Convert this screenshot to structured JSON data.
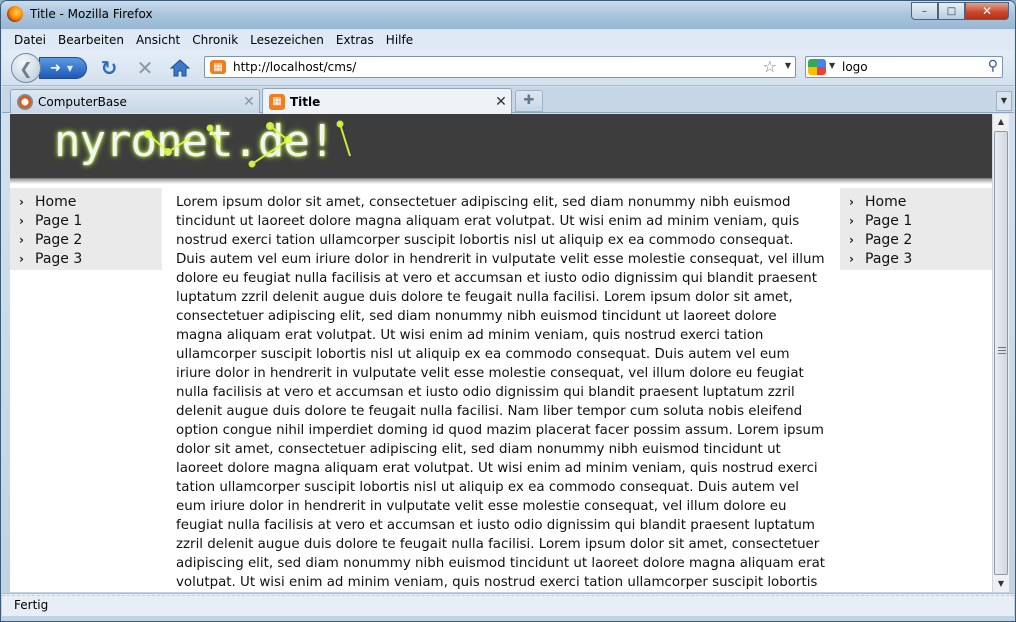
{
  "window": {
    "title": "Title - Mozilla Firefox",
    "controls": {
      "minimize": "–",
      "maximize": "□",
      "close": "✕"
    }
  },
  "menu": [
    {
      "label": "Datei"
    },
    {
      "label": "Bearbeiten"
    },
    {
      "label": "Ansicht"
    },
    {
      "label": "Chronik"
    },
    {
      "label": "Lesezeichen"
    },
    {
      "label": "Extras"
    },
    {
      "label": "Hilfe"
    }
  ],
  "toolbar": {
    "url": "http://localhost/cms/",
    "search_value": "logo",
    "icons": [
      "back-icon",
      "forward-icon",
      "reload-icon",
      "stop-icon",
      "home-icon",
      "bookmark-star-icon",
      "search-icon"
    ]
  },
  "tabs": [
    {
      "label": "ComputerBase",
      "active": false
    },
    {
      "label": "Title",
      "active": true
    }
  ],
  "site": {
    "logo": "nyronet.de!",
    "left_nav": [
      {
        "label": "Home"
      },
      {
        "label": "Page 1"
      },
      {
        "label": "Page 2"
      },
      {
        "label": "Page 3"
      }
    ],
    "right_nav": [
      {
        "label": "Home"
      },
      {
        "label": "Page 1"
      },
      {
        "label": "Page 2"
      },
      {
        "label": "Page 3"
      }
    ],
    "content": "Lorem ipsum dolor sit amet, consectetuer adipiscing elit, sed diam nonummy nibh euismod tincidunt ut laoreet dolore magna aliquam erat volutpat. Ut wisi enim ad minim veniam, quis nostrud exerci tation ullamcorper suscipit lobortis nisl ut aliquip ex ea commodo consequat. Duis autem vel eum iriure dolor in hendrerit in vulputate velit esse molestie consequat, vel illum dolore eu feugiat nulla facilisis at vero et accumsan et iusto odio dignissim qui blandit praesent luptatum zzril delenit augue duis dolore te feugait nulla facilisi. Lorem ipsum dolor sit amet, consectetuer adipiscing elit, sed diam nonummy nibh euismod tincidunt ut laoreet dolore magna aliquam erat volutpat. Ut wisi enim ad minim veniam, quis nostrud exerci tation ullamcorper suscipit lobortis nisl ut aliquip ex ea commodo consequat. Duis autem vel eum iriure dolor in hendrerit in vulputate velit esse molestie consequat, vel illum dolore eu feugiat nulla facilisis at vero et accumsan et iusto odio dignissim qui blandit praesent luptatum zzril delenit augue duis dolore te feugait nulla facilisi. Nam liber tempor cum soluta nobis eleifend option congue nihil imperdiet doming id quod mazim placerat facer possim assum. Lorem ipsum dolor sit amet, consectetuer adipiscing elit, sed diam nonummy nibh euismod tincidunt ut laoreet dolore magna aliquam erat volutpat. Ut wisi enim ad minim veniam, quis nostrud exerci tation ullamcorper suscipit lobortis nisl ut aliquip ex ea commodo consequat. Duis autem vel eum iriure dolor in hendrerit in vulputate velit esse molestie consequat, vel illum dolore eu feugiat nulla facilisis at vero et accumsan et iusto odio dignissim qui blandit praesent luptatum zzril delenit augue duis dolore te feugait nulla facilisi. Lorem ipsum dolor sit amet, consectetuer adipiscing elit, sed diam nonummy nibh euismod tincidunt ut laoreet dolore magna aliquam erat volutpat. Ut wisi enim ad minim veniam, quis nostrud exerci tation ullamcorper suscipit lobortis nisl ut aliquip ex ea commodo"
  },
  "status": "Fertig",
  "colors": {
    "header_bg": "#3d3d3d",
    "logo_glow": "#c8ff4a",
    "sidebar_bg": "#eaeaea",
    "firefox_accent": "#f07d1e"
  }
}
